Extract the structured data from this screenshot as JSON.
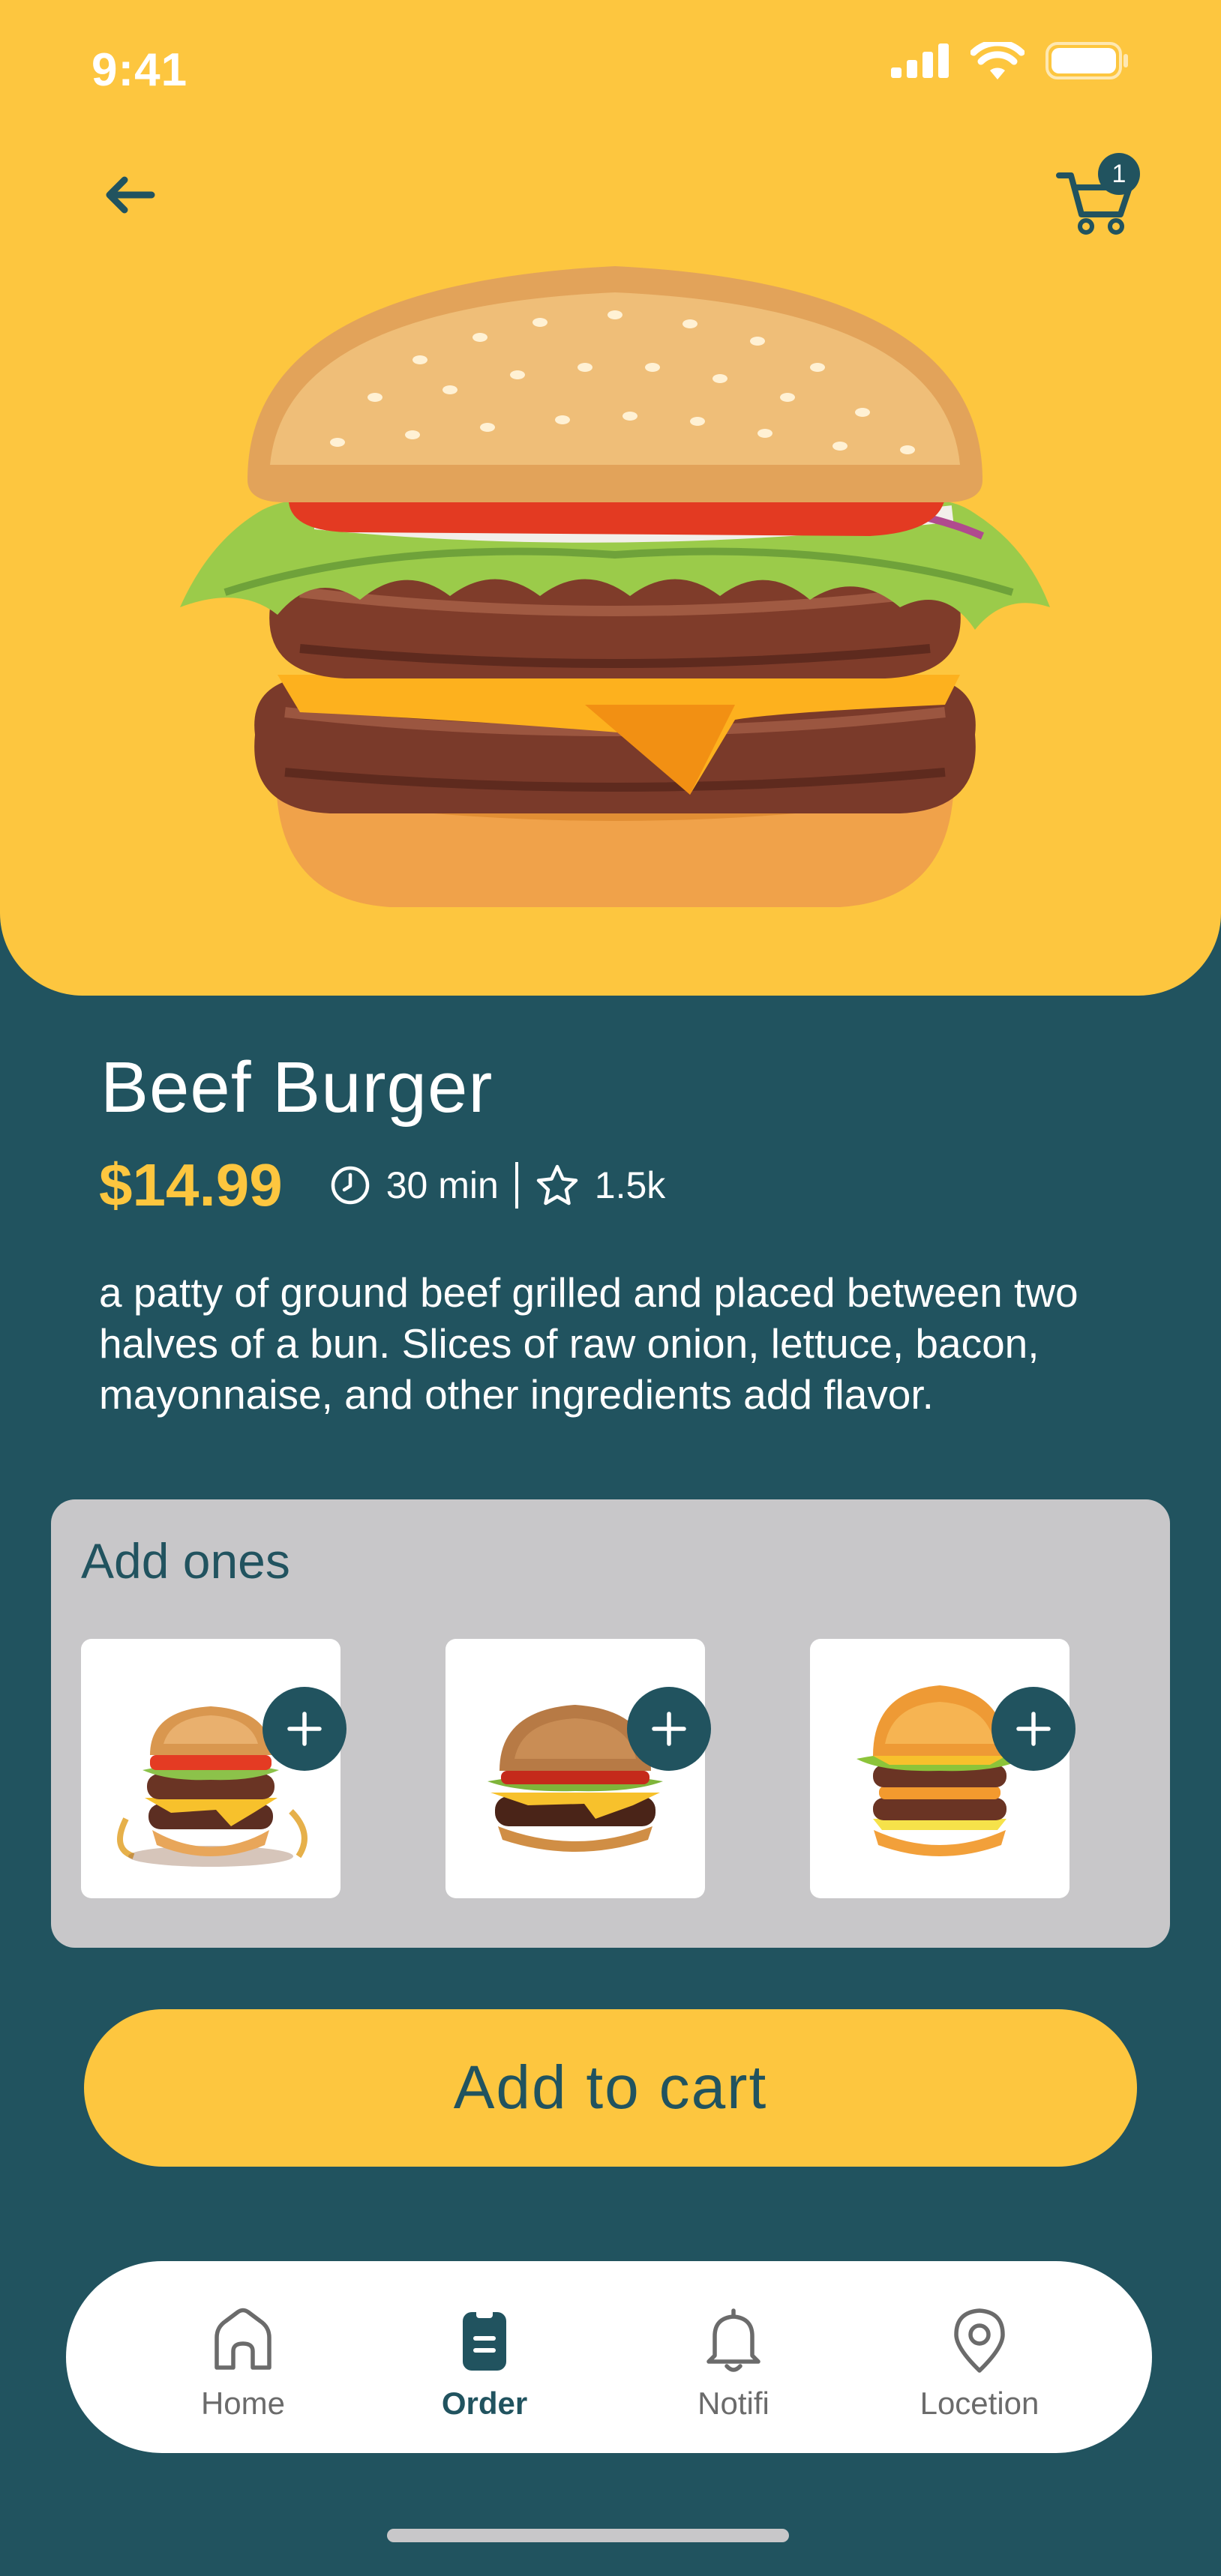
{
  "status_bar": {
    "time": "9:41"
  },
  "header": {
    "cart_count": "1"
  },
  "product": {
    "name": "Beef Burger",
    "price": "$14.99",
    "time": "30 min",
    "rating": "1.5k",
    "description": "a patty of ground beef grilled and placed between two halves of a bun. Slices of raw onion, lettuce, bacon, mayonnaise, and other ingredients add flavor."
  },
  "addons": {
    "title": "Add ones",
    "items": [
      {
        "name": "stacked-burger-addon"
      },
      {
        "name": "classic-burger-addon"
      },
      {
        "name": "double-burger-addon"
      }
    ]
  },
  "cta": {
    "label": "Add to cart"
  },
  "nav": {
    "items": [
      {
        "label": "Home",
        "icon": "home-icon"
      },
      {
        "label": "Order",
        "icon": "order-icon",
        "active": true
      },
      {
        "label": "Notifi",
        "icon": "bell-icon"
      },
      {
        "label": "Locetion",
        "icon": "location-pin-icon"
      }
    ]
  },
  "colors": {
    "accent": "#FDC63F",
    "brand": "#21535F",
    "panel": "#C8C7C9"
  }
}
